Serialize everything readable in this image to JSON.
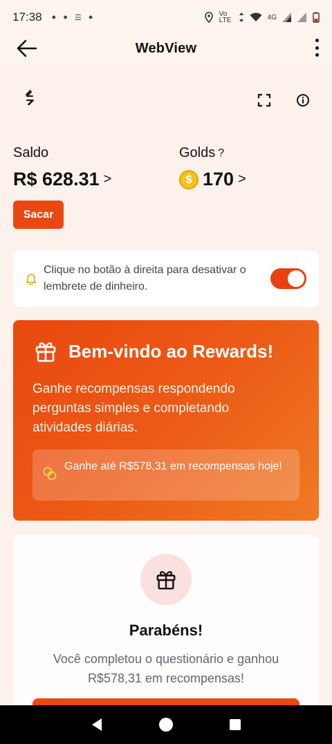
{
  "status": {
    "time": "17:38",
    "net": "4G",
    "volte": "Vo LTE"
  },
  "appbar": {
    "title": "WebView"
  },
  "balance": {
    "saldo_label": "Saldo",
    "saldo_value": "R$ 628.31",
    "golds_label": "Golds",
    "golds_help": "?",
    "golds_value": "170",
    "chevron": ">",
    "coin_symbol": "$"
  },
  "actions": {
    "withdraw_label": "Sacar"
  },
  "reminder": {
    "text": "Clique no botão à direita para desativar o lembrete de dinheiro.",
    "toggle_on": true
  },
  "promo": {
    "title": "Bem-vindo ao Rewards!",
    "description": "Ganhe recompensas respondendo perguntas simples e completando atividades diárias.",
    "highlight": "Ganhe até R$578,31 em recompensas hoje!"
  },
  "congrats": {
    "title": "Parabéns!",
    "text": "Você completou o questionário e ganhou R$578,31 em recompensas!"
  },
  "colors": {
    "accent": "#ea4812",
    "coin": "#f6c21a",
    "background": "#fdf1ec"
  }
}
